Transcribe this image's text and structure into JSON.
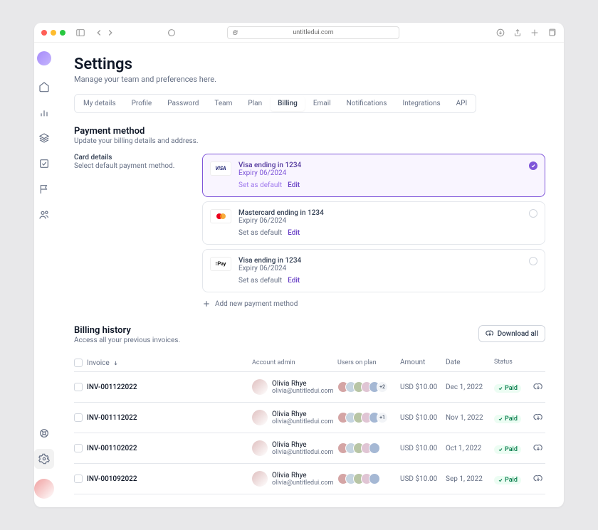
{
  "url": "untitledui.com",
  "page": {
    "title": "Settings",
    "subtitle": "Manage your team and preferences here."
  },
  "tabs": [
    "My details",
    "Profile",
    "Password",
    "Team",
    "Plan",
    "Billing",
    "Email",
    "Notifications",
    "Integrations",
    "API"
  ],
  "activeTab": "Billing",
  "payment": {
    "title": "Payment method",
    "subtitle": "Update your billing details and address.",
    "cardDetails": {
      "title": "Card details",
      "subtitle": "Select default payment method."
    },
    "cards": [
      {
        "brand": "visa",
        "title": "Visa ending in 1234",
        "expiry": "Expiry 06/2024",
        "selected": true
      },
      {
        "brand": "mastercard",
        "title": "Mastercard ending in 1234",
        "expiry": "Expiry 06/2024",
        "selected": false
      },
      {
        "brand": "applepay",
        "title": "Visa ending in 1234",
        "expiry": "Expiry 06/2024",
        "selected": false
      }
    ],
    "setDefault": "Set as default",
    "edit": "Edit",
    "addNew": "Add new payment method"
  },
  "billing": {
    "title": "Billing history",
    "subtitle": "Access all your previous invoices.",
    "downloadAll": "Download all",
    "columns": {
      "invoice": "Invoice",
      "admin": "Account admin",
      "users": "Users on plan",
      "amount": "Amount",
      "date": "Date",
      "status": "Status"
    },
    "rows": [
      {
        "invoice": "INV-001122022",
        "admin": {
          "name": "Olivia Rhye",
          "email": "olivia@untitledui.com"
        },
        "extra": "+2",
        "amount": "USD $10.00",
        "date": "Dec 1, 2022",
        "status": "Paid"
      },
      {
        "invoice": "INV-001112022",
        "admin": {
          "name": "Olivia Rhye",
          "email": "olivia@untitledui.com"
        },
        "extra": "+1",
        "amount": "USD $10.00",
        "date": "Nov 1, 2022",
        "status": "Paid"
      },
      {
        "invoice": "INV-001102022",
        "admin": {
          "name": "Olivia Rhye",
          "email": "olivia@untitledui.com"
        },
        "extra": "",
        "amount": "USD $10.00",
        "date": "Oct 1, 2022",
        "status": "Paid"
      },
      {
        "invoice": "INV-001092022",
        "admin": {
          "name": "Olivia Rhye",
          "email": "olivia@untitledui.com"
        },
        "extra": "",
        "amount": "USD $10.00",
        "date": "Sep 1, 2022",
        "status": "Paid"
      }
    ]
  }
}
